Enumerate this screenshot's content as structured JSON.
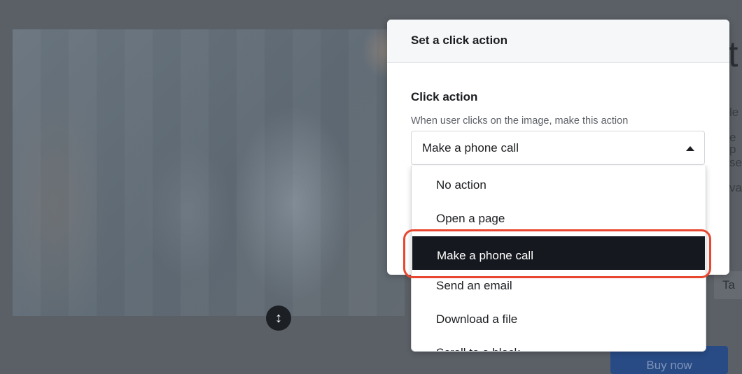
{
  "modal": {
    "title": "Set a click action",
    "field_label": "Click action",
    "field_help": "When user clicks on the image, make this action",
    "selected_value": "Make a phone call",
    "options": [
      {
        "label": "No action",
        "selected": false
      },
      {
        "label": "Open a page",
        "selected": false
      },
      {
        "label": "Make a phone call",
        "selected": true
      },
      {
        "label": "Send an email",
        "selected": false
      },
      {
        "label": "Download a file",
        "selected": false
      },
      {
        "label": "Scroll to a block",
        "selected": false
      }
    ]
  },
  "background": {
    "heading_fragment": "t",
    "text_fragments": [
      "le",
      "e p",
      "se",
      "va"
    ],
    "tag_label": "Ta",
    "buy_button_label": "Buy now"
  },
  "colors": {
    "highlight": "#e8472f",
    "selected_bg": "#15181e",
    "buy_button": "#284b86"
  },
  "icons": {
    "resize_handle": "vertical-resize-icon",
    "select_caret": "caret-up-icon"
  }
}
